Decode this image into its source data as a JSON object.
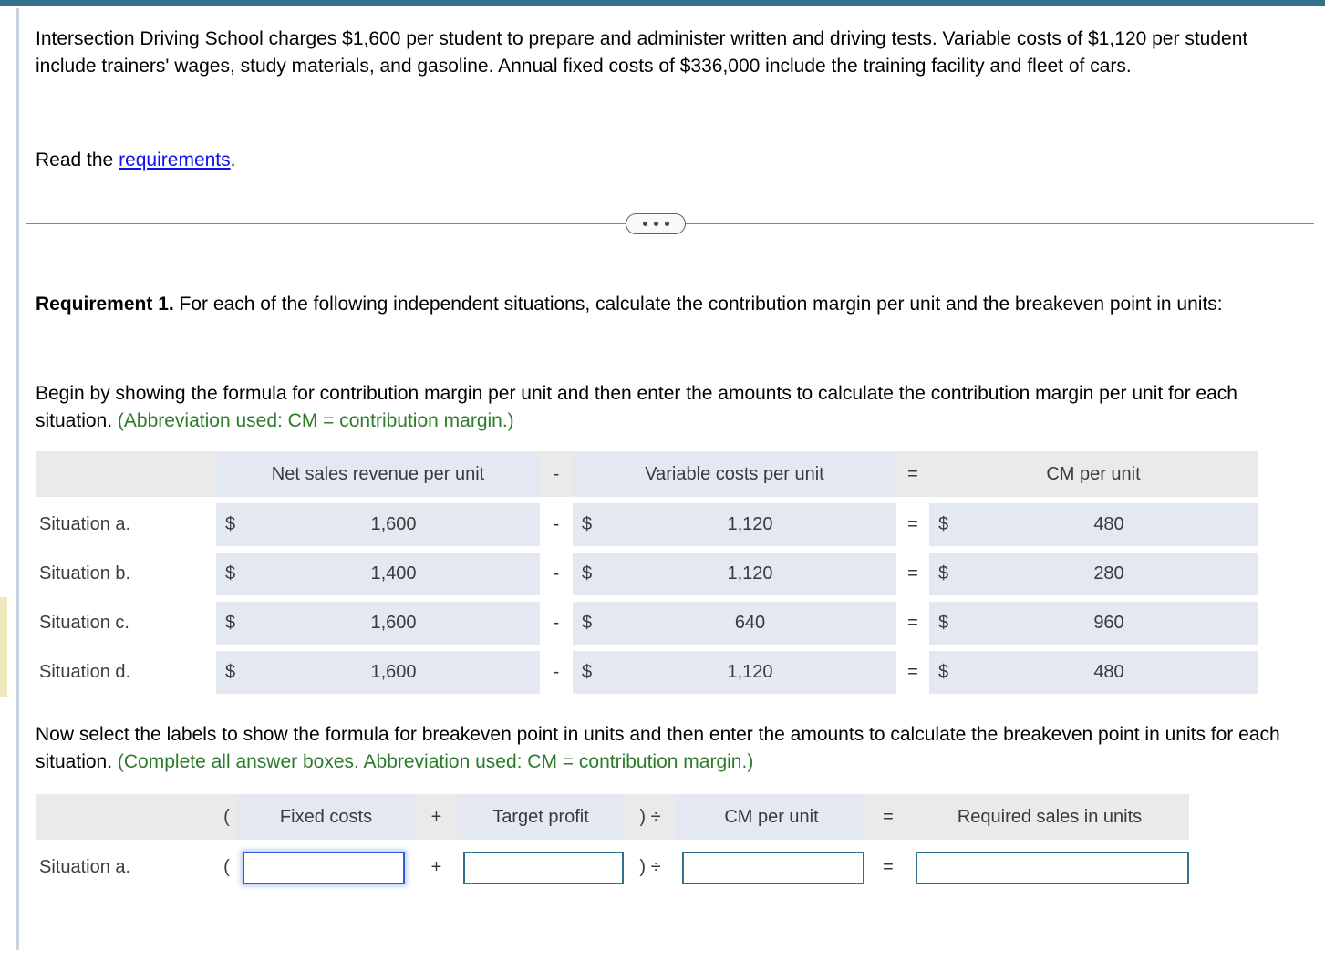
{
  "theme": {
    "accent_bar": "#33708c",
    "link": "#1010ee",
    "green_note": "#2c7a2c",
    "header_gray": "#eaeaea",
    "header_selectable": "#e3e8f2",
    "amount_cell": "#e4e8f1",
    "input_border": "#31708f",
    "input_focus_border": "#2b5fd9",
    "gutter_marker": "#efe9bd"
  },
  "intro": {
    "paragraph": "Intersection Driving School charges $1,600 per student to prepare and administer written and driving tests. Variable costs of $1,120 per student include trainers' wages, study materials, and gasoline. Annual fixed costs of $336,000 include the training facility and fleet of cars.",
    "read_prefix": "Read the ",
    "read_link": "requirements",
    "read_suffix": "."
  },
  "divider": {
    "ellipsis_label": "..."
  },
  "requirement": {
    "label": "Requirement 1.",
    "text": " For each of the following independent situations, calculate the contribution margin per unit and the breakeven point in units:",
    "begin_text": "Begin by showing the formula for contribution margin per unit and then enter the amounts to calculate the contribution margin per unit for each situation. ",
    "begin_note": "(Abbreviation used: CM = contribution margin.)",
    "now_text": "Now select the labels to show the formula for breakeven point in units and then enter the amounts to calculate the breakeven point in units for each situation. ",
    "now_note": "(Complete all answer boxes. Abbreviation used: CM = contribution margin.)"
  },
  "cm_table": {
    "headers": {
      "blank": "",
      "col1": "Net sales revenue per unit",
      "op1": "-",
      "col2": "Variable costs per unit",
      "op2": "=",
      "col3": "CM per unit"
    },
    "rows": [
      {
        "label": "Situation a.",
        "net_sales_currency": "$",
        "net_sales_value": "1,600",
        "op1": "-",
        "variable_currency": "$",
        "variable_value": "1,120",
        "op2": "=",
        "cm_currency": "$",
        "cm_value": "480"
      },
      {
        "label": "Situation b.",
        "net_sales_currency": "$",
        "net_sales_value": "1,400",
        "op1": "-",
        "variable_currency": "$",
        "variable_value": "1,120",
        "op2": "=",
        "cm_currency": "$",
        "cm_value": "280"
      },
      {
        "label": "Situation c.",
        "net_sales_currency": "$",
        "net_sales_value": "1,600",
        "op1": "-",
        "variable_currency": "$",
        "variable_value": "640",
        "op2": "=",
        "cm_currency": "$",
        "cm_value": "960"
      },
      {
        "label": "Situation d.",
        "net_sales_currency": "$",
        "net_sales_value": "1,600",
        "op1": "-",
        "variable_currency": "$",
        "variable_value": "1,120",
        "op2": "=",
        "cm_currency": "$",
        "cm_value": "480"
      }
    ]
  },
  "breakeven_table": {
    "headers": {
      "blank": "",
      "open_paren": "(",
      "col1": "Fixed costs",
      "plus": "+",
      "col2": "Target profit",
      "close_div": ") ÷",
      "col3": "CM per unit",
      "equals": "=",
      "col4": "Required sales in units"
    },
    "rows": [
      {
        "label": "Situation a.",
        "open_paren": "(",
        "fixed_costs_value": "",
        "plus": "+",
        "target_profit_value": "",
        "close_div": ") ÷",
        "cm_per_unit_value": "",
        "equals": "=",
        "required_sales_value": ""
      }
    ]
  }
}
